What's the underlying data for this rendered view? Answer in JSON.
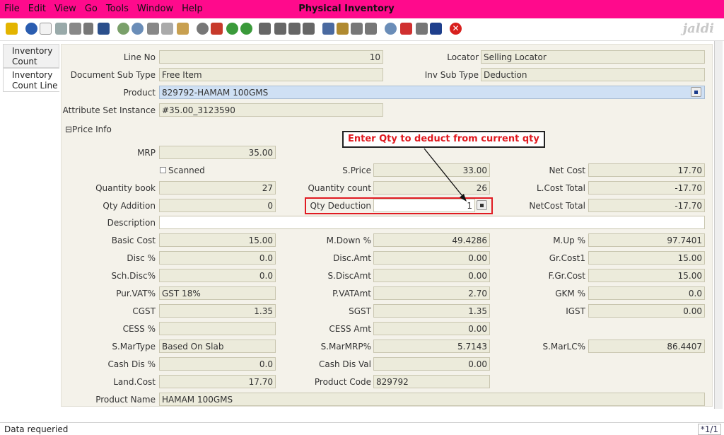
{
  "window": {
    "title": "Physical Inventory"
  },
  "menu": [
    "File",
    "Edit",
    "View",
    "Go",
    "Tools",
    "Window",
    "Help"
  ],
  "toolbar": {
    "logo": "jaldi"
  },
  "tabs": [
    "Inventory Count",
    "Inventory Count Line"
  ],
  "form": {
    "line_no": {
      "label": "Line No",
      "value": "10"
    },
    "locator": {
      "label": "Locator",
      "value": "Selling Locator"
    },
    "doc_sub_type": {
      "label": "Document Sub Type",
      "value": "Free Item"
    },
    "inv_sub_type": {
      "label": "Inv Sub Type",
      "value": "Deduction"
    },
    "product": {
      "label": "Product",
      "value": "829792-HAMAM 100GMS"
    },
    "attr_set": {
      "label": "Attribute Set Instance",
      "value": "#35.00_3123590"
    },
    "section": "⊟Price Info",
    "mrp": {
      "label": "MRP",
      "value": "35.00"
    },
    "scanned": {
      "label": "Scanned"
    },
    "s_price": {
      "label": "S.Price",
      "value": "33.00"
    },
    "net_cost": {
      "label": "Net Cost",
      "value": "17.70"
    },
    "qty_book": {
      "label": "Quantity book",
      "value": "27"
    },
    "qty_count": {
      "label": "Quantity count",
      "value": "26"
    },
    "lcost_total": {
      "label": "L.Cost Total",
      "value": "-17.70"
    },
    "qty_addition": {
      "label": "Qty Addition",
      "value": "0"
    },
    "qty_deduction": {
      "label": "Qty Deduction",
      "value": "1"
    },
    "netcost_total": {
      "label": "NetCost Total",
      "value": "-17.70"
    },
    "description": {
      "label": "Description",
      "value": ""
    },
    "basic_cost": {
      "label": "Basic Cost",
      "value": "15.00"
    },
    "m_down": {
      "label": "M.Down %",
      "value": "49.4286"
    },
    "m_up": {
      "label": "M.Up %",
      "value": "97.7401"
    },
    "disc": {
      "label": "Disc %",
      "value": "0.0"
    },
    "disc_amt": {
      "label": "Disc.Amt",
      "value": "0.00"
    },
    "gr_cost1": {
      "label": "Gr.Cost1",
      "value": "15.00"
    },
    "sch_disc": {
      "label": "Sch.Disc%",
      "value": "0.0"
    },
    "s_disc_amt": {
      "label": "S.DiscAmt",
      "value": "0.00"
    },
    "f_gr_cost": {
      "label": "F.Gr.Cost",
      "value": "15.00"
    },
    "pur_vat": {
      "label": "Pur.VAT%",
      "value": "GST 18%"
    },
    "p_vat_amt": {
      "label": "P.VATAmt",
      "value": "2.70"
    },
    "gkm": {
      "label": "GKM %",
      "value": "0.0"
    },
    "cgst": {
      "label": "CGST",
      "value": "1.35"
    },
    "sgst": {
      "label": "SGST",
      "value": "1.35"
    },
    "igst": {
      "label": "IGST",
      "value": "0.00"
    },
    "cess": {
      "label": "CESS %",
      "value": ""
    },
    "cess_amt": {
      "label": "CESS Amt",
      "value": "0.00"
    },
    "s_mar_type": {
      "label": "S.MarType",
      "value": "Based On Slab"
    },
    "s_mar_mrp": {
      "label": "S.MarMRP%",
      "value": "5.7143"
    },
    "s_mar_lc": {
      "label": "S.MarLC%",
      "value": "86.4407"
    },
    "cash_dis": {
      "label": "Cash Dis %",
      "value": "0.0"
    },
    "cash_dis_val": {
      "label": "Cash Dis Val",
      "value": "0.00"
    },
    "land_cost": {
      "label": "Land.Cost",
      "value": "17.70"
    },
    "product_code": {
      "label": "Product Code",
      "value": "829792"
    },
    "product_name": {
      "label": "Product Name",
      "value": "HAMAM 100GMS"
    }
  },
  "annotation": "Enter Qty to deduct from current qty",
  "status": {
    "message": "Data requeried",
    "page": "*1/1"
  },
  "colors": {
    "titlebar": "#ff0a8c",
    "highlight": "#e01b22",
    "field": "#ecebdb"
  }
}
